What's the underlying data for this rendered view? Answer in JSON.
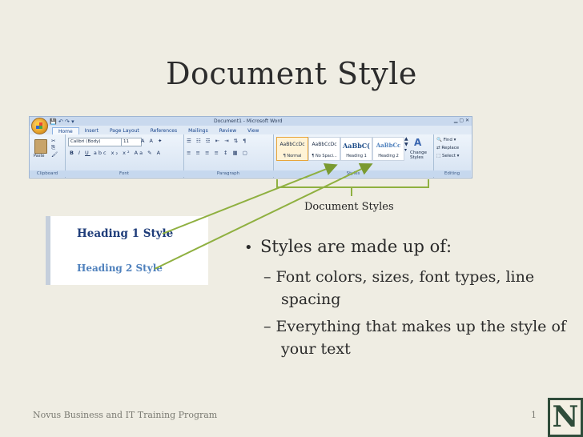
{
  "slide": {
    "title": "Document Style",
    "footer": "Novus Business and IT Training Program",
    "page_number": "1",
    "logo_letter": "N",
    "accent_color": "#8fb040"
  },
  "ribbon": {
    "window_title": "Document1 - Microsoft Word",
    "tabs": [
      "Home",
      "Insert",
      "Page Layout",
      "References",
      "Mailings",
      "Review",
      "View"
    ],
    "groups": [
      "Clipboard",
      "Font",
      "Paragraph",
      "Styles",
      "Editing"
    ],
    "paste_label": "Paste",
    "font_name": "Calibri (Body)",
    "font_size": "11",
    "styles": [
      {
        "sample": "AaBbCcDc",
        "name": "¶ Normal"
      },
      {
        "sample": "AaBbCcDc",
        "name": "¶ No Spaci..."
      },
      {
        "sample": "AaBbC(",
        "name": "Heading 1"
      },
      {
        "sample": "AaBbCc",
        "name": "Heading 2"
      }
    ],
    "change_styles": "Change Styles",
    "editing_items": [
      "Find",
      "Replace",
      "Select"
    ]
  },
  "callout": {
    "label": "Document Styles"
  },
  "headings": {
    "h1": "Heading 1 Style",
    "h2": "Heading 2 Style"
  },
  "bullets": {
    "main": "Styles are made up of:",
    "sub": [
      "Font colors, sizes, font types, line spacing",
      "Everything that makes up the style of your text"
    ]
  }
}
